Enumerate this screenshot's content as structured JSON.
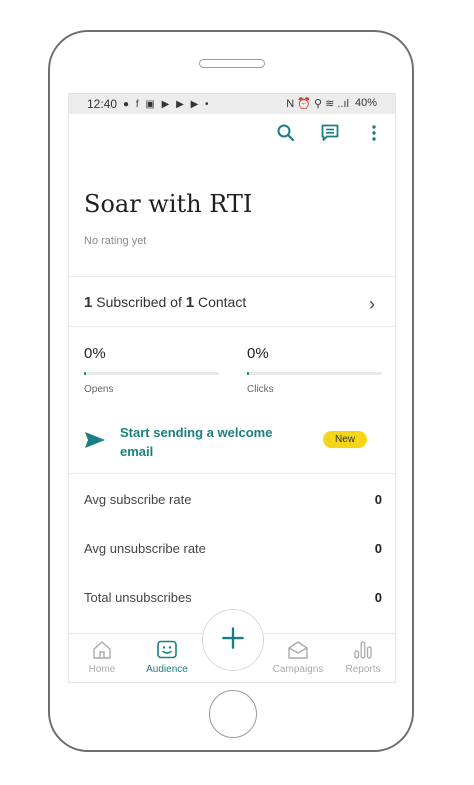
{
  "statusbar": {
    "time": "12:40",
    "left_icons": "● f ▣ ▶ ▶ ▶ •",
    "right_icons": "N ⏰ ⚲ ≋ ..ıl",
    "battery": "40%"
  },
  "audience": {
    "title": "Soar with RTI",
    "rating": "No rating yet",
    "subscribed_count": "1",
    "subscribed_label": "Subscribed of",
    "contact_count": "1",
    "contact_label": "Contact",
    "chevron": "›"
  },
  "stats": {
    "opens": {
      "value": "0%",
      "label": "Opens",
      "fraction": 0.0
    },
    "clicks": {
      "value": "0%",
      "label": "Clicks",
      "fraction": 0.0
    }
  },
  "cta": {
    "text": "Start sending a welcome email",
    "badge": "New"
  },
  "metrics": [
    {
      "label": "Avg subscribe rate",
      "value": "0"
    },
    {
      "label": "Avg unsubscribe rate",
      "value": "0"
    },
    {
      "label": "Total unsubscribes",
      "value": "0"
    }
  ],
  "nav": {
    "home": "Home",
    "audience": "Audience",
    "campaigns": "Campaigns",
    "reports": "Reports",
    "fab_icon": "plus-icon"
  },
  "colors": {
    "accent": "#1a7f82",
    "badge": "#f5d616",
    "progress": "#1f9a6c"
  }
}
